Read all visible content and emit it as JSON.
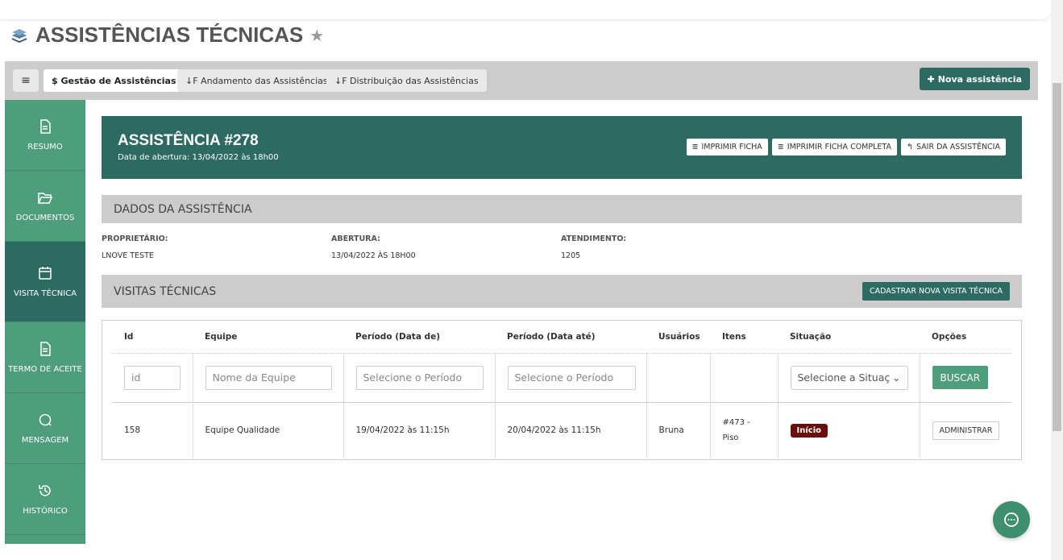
{
  "page": {
    "title": "ASSISTÊNCIAS TÉCNICAS"
  },
  "toolbar": {
    "tabs": [
      {
        "label": "Gestão de Assistências",
        "prefix": "$"
      },
      {
        "label": "Andamento das Assistências",
        "prefix": "↓F"
      },
      {
        "label": "Distribuição das Assistências",
        "prefix": "↓F"
      }
    ],
    "new_button": "Nova assistência"
  },
  "sidebar": {
    "items": [
      {
        "label": "RESUMO",
        "icon": "file-icon"
      },
      {
        "label": "DOCUMENTOS",
        "icon": "folder-open-icon"
      },
      {
        "label": "VISITA TÉCNICA",
        "icon": "calendar-icon"
      },
      {
        "label": "TERMO DE ACEITE",
        "icon": "file-icon"
      },
      {
        "label": "MENSAGEM",
        "icon": "chat-bubble-icon"
      },
      {
        "label": "HISTÓRICO",
        "icon": "history-icon"
      }
    ]
  },
  "header": {
    "title": "ASSISTÊNCIA #278",
    "subtitle": "Data de abertura: 13/04/2022 às 18h00",
    "buttons": [
      "IMPRIMIR FICHA",
      "IMPRIMIR FICHA COMPLETA",
      "SAIR DA ASSISTÊNCIA"
    ]
  },
  "dados": {
    "title": "DADOS DA ASSISTÊNCIA",
    "fields": [
      {
        "label": "PROPRIETÁRIO:",
        "value": "LNOVE TESTE"
      },
      {
        "label": "ABERTURA:",
        "value": "13/04/2022 ÀS 18H00"
      },
      {
        "label": "ATENDIMENTO:",
        "value": "1205"
      }
    ]
  },
  "visitas": {
    "title": "VISITAS TÉCNICAS",
    "add_button": "CADASTRAR NOVA VISITA TÉCNICA",
    "columns": [
      "Id",
      "Equipe",
      "Período (Data de)",
      "Período (Data até)",
      "Usuários",
      "Itens",
      "Situação",
      "Opções"
    ],
    "filters": {
      "id_placeholder": "id",
      "equipe_placeholder": "Nome da Equipe",
      "data_de_placeholder": "Selecione o Período",
      "data_ate_placeholder": "Selecione o Período",
      "situacao_select": "Selecione a Situação",
      "search_button": "BUSCAR"
    },
    "rows": [
      {
        "id": "158",
        "equipe": "Equipe Qualidade",
        "data_de": "19/04/2022 às 11:15h",
        "data_ate": "20/04/2022 às 11:15h",
        "usuarios": "Bruna",
        "itens": "#473 -",
        "itens2": "Piso",
        "situacao": "Início",
        "opcao": "ADMINISTRAR"
      }
    ]
  },
  "colors": {
    "primary": "#2d6b62",
    "secondary": "#4e9d7d",
    "badge": "#6b0d0d"
  }
}
